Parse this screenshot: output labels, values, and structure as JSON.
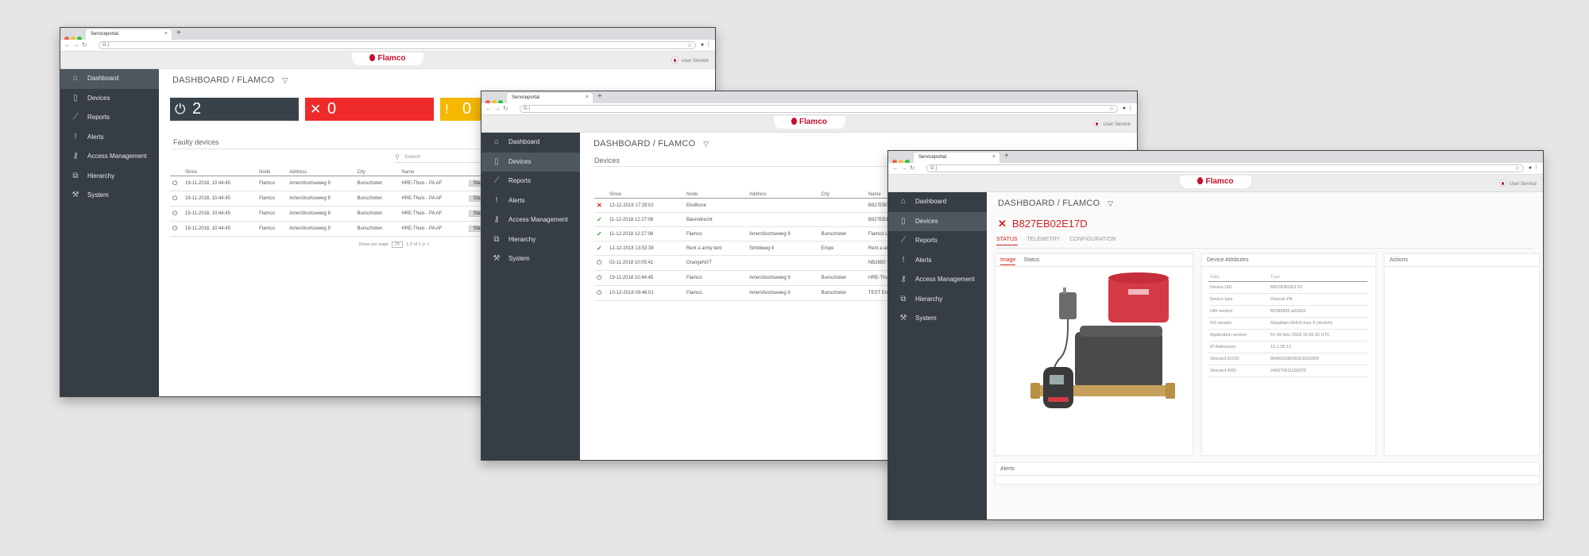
{
  "browser": {
    "tab_title": "Serviceportal"
  },
  "app": {
    "brand": "Flamco",
    "user": "User Service"
  },
  "sidebar": {
    "items": [
      {
        "label": "Dashboard",
        "icon": "home-icon"
      },
      {
        "label": "Devices",
        "icon": "tablet-icon"
      },
      {
        "label": "Reports",
        "icon": "chart-icon"
      },
      {
        "label": "Alerts",
        "icon": "exclamation-icon"
      },
      {
        "label": "Access Management",
        "icon": "key-icon"
      },
      {
        "label": "Hierarchy",
        "icon": "sitemap-icon"
      },
      {
        "label": "System",
        "icon": "wrench-icon"
      }
    ]
  },
  "breadcrumb": "DASHBOARD / FLAMCO",
  "dashboard": {
    "cards": [
      {
        "value": "2",
        "color": "#3a4249",
        "icon": "plug-icon"
      },
      {
        "value": "0",
        "color": "#ee2a2a",
        "icon": "x-icon"
      },
      {
        "value": "0",
        "color": "#f5b700",
        "icon": "exclamation-icon"
      }
    ],
    "faulty_title": "Faulty devices",
    "search_placeholder": "Search",
    "columns": [
      "Since",
      "Node",
      "Address",
      "City",
      "Name"
    ],
    "rows": [
      {
        "since": "19-11-2018, 10:44:45",
        "node": "Flamco",
        "address": "Amersfoortseweg 9",
        "city": "Bunschoten",
        "name": "HRE-Thuis - PA AF",
        "action": "State"
      },
      {
        "since": "19-11-2018, 10:44:45",
        "node": "Flamco",
        "address": "Amersfoortseweg 9",
        "city": "Bunschoten",
        "name": "HRE-Thuis - PA AF",
        "action": "State"
      },
      {
        "since": "19-11-2018, 10:44:45",
        "node": "Flamco",
        "address": "Amersfoortseweg 9",
        "city": "Bunschoten",
        "name": "HRE-Thuis - PA AF",
        "action": "State"
      },
      {
        "since": "19-11-2018, 10:44:45",
        "node": "Flamco",
        "address": "Amersfoortseweg 9",
        "city": "Bunschoten",
        "name": "HRE-Thuis - PA AF",
        "action": "State"
      }
    ],
    "pager": {
      "label": "Rows per page",
      "value": "25",
      "range": "1-2 of 1"
    }
  },
  "devices": {
    "title": "Devices",
    "columns": [
      "Since",
      "Node",
      "Address",
      "City",
      "Name"
    ],
    "rows": [
      {
        "status": "error",
        "since": "12-12-2018 17:29:02",
        "node": "Eindhove",
        "address": "",
        "city": "",
        "name": "B827EB02E17D"
      },
      {
        "status": "ok",
        "since": "11-12-2018 12:27:08",
        "node": "Barendrecht",
        "address": "",
        "city": "",
        "name": "B827EB1F372"
      },
      {
        "status": "ok",
        "since": "11-12-2018 12:27:08",
        "node": "Flamco",
        "address": "Amersfoortseweg 9",
        "city": "Bunschoten",
        "name": "Flamco Lab -"
      },
      {
        "status": "ok",
        "since": "12-12-2018 13:53:39",
        "node": "Rent a army tent",
        "address": "Simbiweg 4",
        "city": "Empe",
        "name": "Rent a army te"
      },
      {
        "status": "plug",
        "since": "02-11-2018 10:05:41",
        "node": "OrangeNXT",
        "address": "",
        "city": "",
        "name": "NB2650"
      },
      {
        "status": "plug",
        "since": "19-11-2018 10:44:45",
        "node": "Flamco",
        "address": "Amersfoortseweg 9",
        "city": "Bunschoten",
        "name": "HRE-Thuis - PA"
      },
      {
        "status": "plug",
        "since": "10-12-2018 09:46:01",
        "node": "Flamco",
        "address": "Amersfoortseweg 9",
        "city": "Bunschoten",
        "name": "TEST Email"
      }
    ]
  },
  "detail": {
    "device_id": "B827EB02E17D",
    "tabs": [
      "STATUS",
      "TELEMETRY",
      "CONFIGURATION"
    ],
    "image_tabs": [
      "Image",
      "Status"
    ],
    "attributes_title": "Device Attributes",
    "actions_title": "Actions",
    "alerts_title": "Alerts",
    "attr_columns": [
      "Data",
      "Type"
    ],
    "attributes": [
      {
        "key": "Device UID",
        "value": "B827EB02E17D"
      },
      {
        "key": "Device type",
        "value": "Flexcon PA"
      },
      {
        "key": "HW version",
        "value": "BCM2835 a020d3"
      },
      {
        "key": "OS version",
        "value": "Raspbian GNU/Linux 9 (stretch)"
      },
      {
        "key": "Application version",
        "value": "Fri 09 Nov 2018 16:26:32 UTC"
      },
      {
        "key": "IP Addresses",
        "value": "10.1.28.13"
      },
      {
        "key": "Simcard ICCID",
        "value": "89462038005001816009"
      },
      {
        "key": "Simcard IMSI",
        "value": "240075811169370"
      }
    ]
  }
}
